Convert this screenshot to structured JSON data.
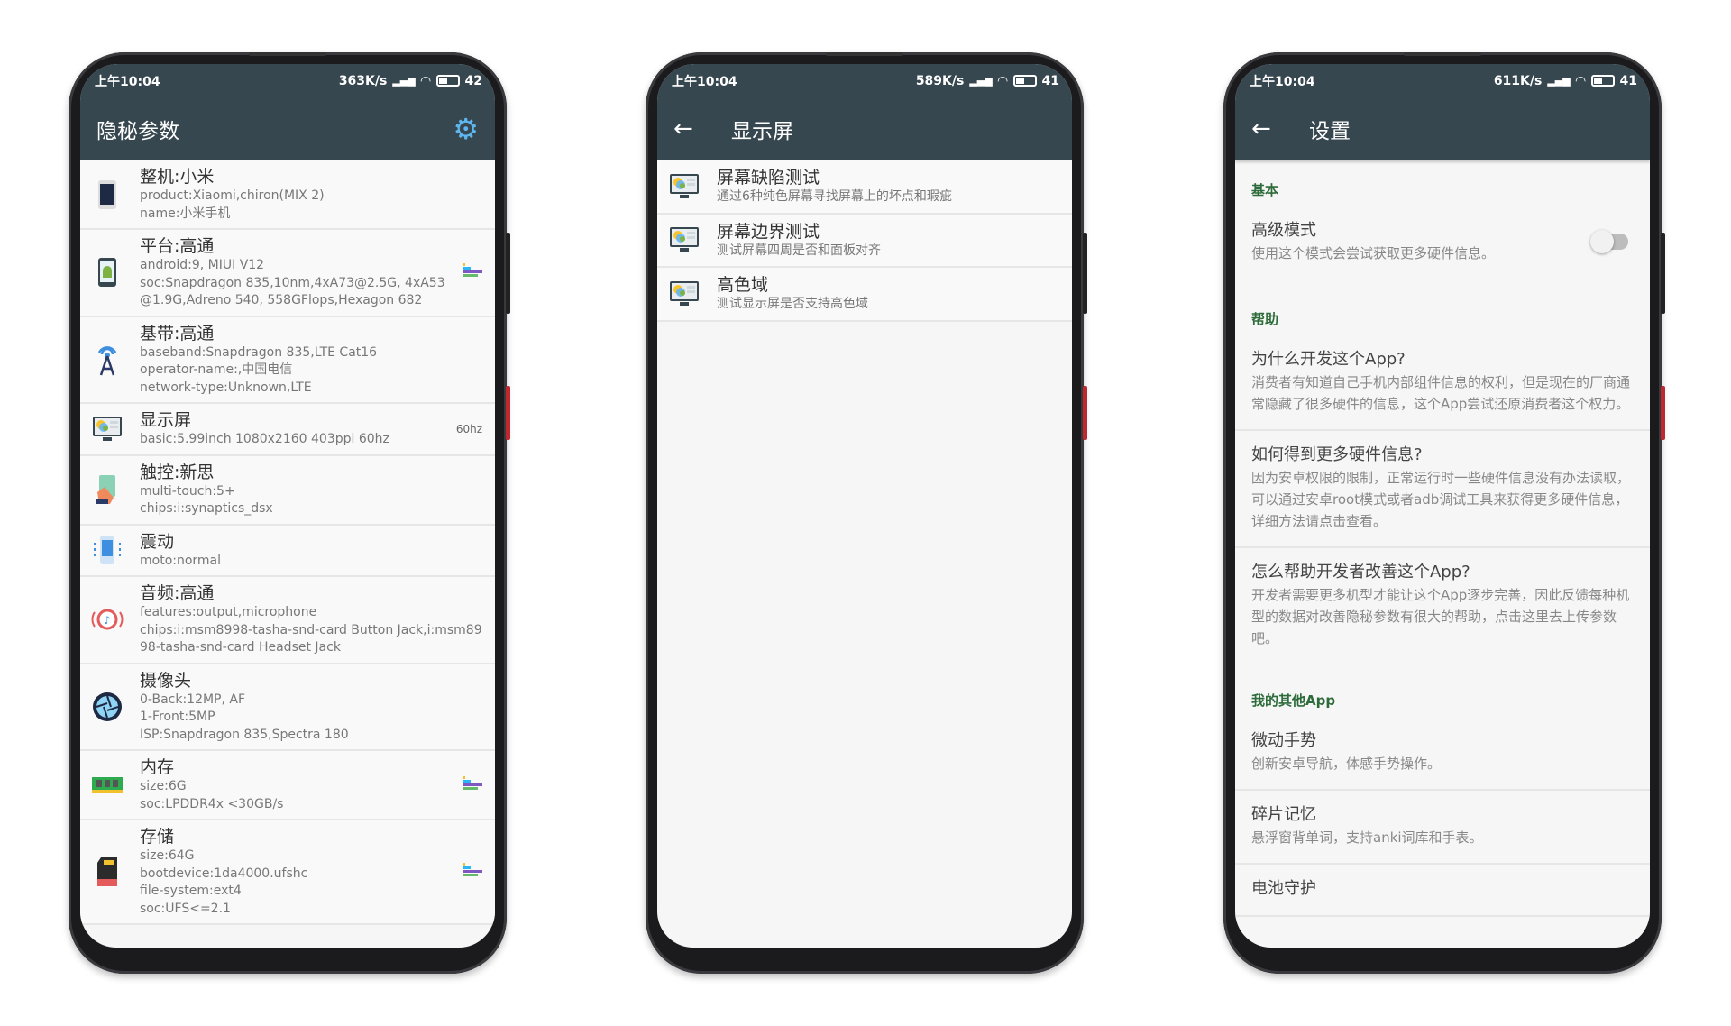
{
  "phones": [
    {
      "status": {
        "time": "上午10:04",
        "speed": "363K/s",
        "battery": "42"
      },
      "title": "隐秘参数",
      "icon": "gear-icon",
      "items": [
        {
          "icon": "phone-icon",
          "title": "整机:小米",
          "lines": [
            "product:Xiaomi,chiron(MIX 2)",
            "name:小米手机"
          ]
        },
        {
          "icon": "android-icon",
          "title": "平台:高通",
          "lines": [
            "android:9, MIUI V12",
            "soc:Snapdragon 835,10nm,4xA73@2.5G, 4xA53@1.9G,Adreno 540, 558GFlops,Hexagon 682"
          ],
          "chart": true
        },
        {
          "icon": "antenna-icon",
          "title": "基带:高通",
          "lines": [
            "baseband:Snapdragon 835,LTE Cat16",
            "operator-name:,中国电信",
            "network-type:Unknown,LTE"
          ]
        },
        {
          "icon": "monitor-icon",
          "title": "显示屏",
          "lines": [
            "basic:5.99inch 1080x2160 403ppi 60hz"
          ],
          "right": "60hz"
        },
        {
          "icon": "touch-icon",
          "title": "触控:新思",
          "lines": [
            "multi-touch:5+",
            "chips:i:synaptics_dsx"
          ]
        },
        {
          "icon": "vibration-icon",
          "title": "震动",
          "lines": [
            "moto:normal"
          ]
        },
        {
          "icon": "audio-icon",
          "title": "音频:高通",
          "lines": [
            "features:output,microphone",
            "chips:i:msm8998-tasha-snd-card Button Jack,i:msm8998-tasha-snd-card Headset Jack"
          ]
        },
        {
          "icon": "camera-icon",
          "title": "摄像头",
          "lines": [
            "0-Back:12MP, AF",
            "1-Front:5MP",
            "ISP:Snapdragon 835,Spectra 180"
          ]
        },
        {
          "icon": "ram-icon",
          "title": "内存",
          "lines": [
            "size:6G",
            "soc:LPDDR4x <30GB/s"
          ],
          "chart": true
        },
        {
          "icon": "sdcard-icon",
          "title": "存储",
          "lines": [
            "size:64G",
            "bootdevice:1da4000.ufshc",
            "file-system:ext4",
            "soc:UFS<=2.1"
          ],
          "chart": true
        }
      ]
    },
    {
      "status": {
        "time": "上午10:04",
        "speed": "589K/s",
        "battery": "41"
      },
      "title": "显示屏",
      "items": [
        {
          "title": "屏幕缺陷测试",
          "sub": "通过6种纯色屏幕寻找屏幕上的坏点和瑕疵"
        },
        {
          "title": "屏幕边界测试",
          "sub": "测试屏幕四周是否和面板对齐"
        },
        {
          "title": "高色域",
          "sub": "测试显示屏是否支持高色域"
        }
      ]
    },
    {
      "status": {
        "time": "上午10:04",
        "speed": "611K/s",
        "battery": "41"
      },
      "title": "设置",
      "sections": {
        "basic": "基本",
        "help": "帮助",
        "other": "我的其他App"
      },
      "advanced": {
        "title": "高级模式",
        "sub": "使用这个模式会尝试获取更多硬件信息。",
        "enabled": false
      },
      "help": [
        {
          "title": "为什么开发这个App?",
          "sub": "消费者有知道自己手机内部组件信息的权利，但是现在的厂商通常隐藏了很多硬件的信息，这个App尝试还原消费者这个权力。"
        },
        {
          "title": "如何得到更多硬件信息?",
          "sub": "因为安卓权限的限制，正常运行时一些硬件信息没有办法读取，可以通过安卓root模式或者adb调试工具来获得更多硬件信息，详细方法请点击查看。"
        },
        {
          "title": "怎么帮助开发者改善这个App?",
          "sub": "开发者需要更多机型才能让这个App逐步完善，因此反馈每种机型的数据对改善隐秘参数有很大的帮助，点击这里去上传参数吧。"
        }
      ],
      "apps": [
        {
          "title": "微动手势",
          "sub": "创新安卓导航，体感手势操作。"
        },
        {
          "title": "碎片记忆",
          "sub": "悬浮窗背单词，支持anki词库和手表。"
        },
        {
          "title": "电池守护",
          "sub": ""
        }
      ]
    }
  ],
  "colors": {
    "toolbar": "#37474f",
    "section": "#2e6b3a",
    "accent": "#5fb6ef"
  }
}
